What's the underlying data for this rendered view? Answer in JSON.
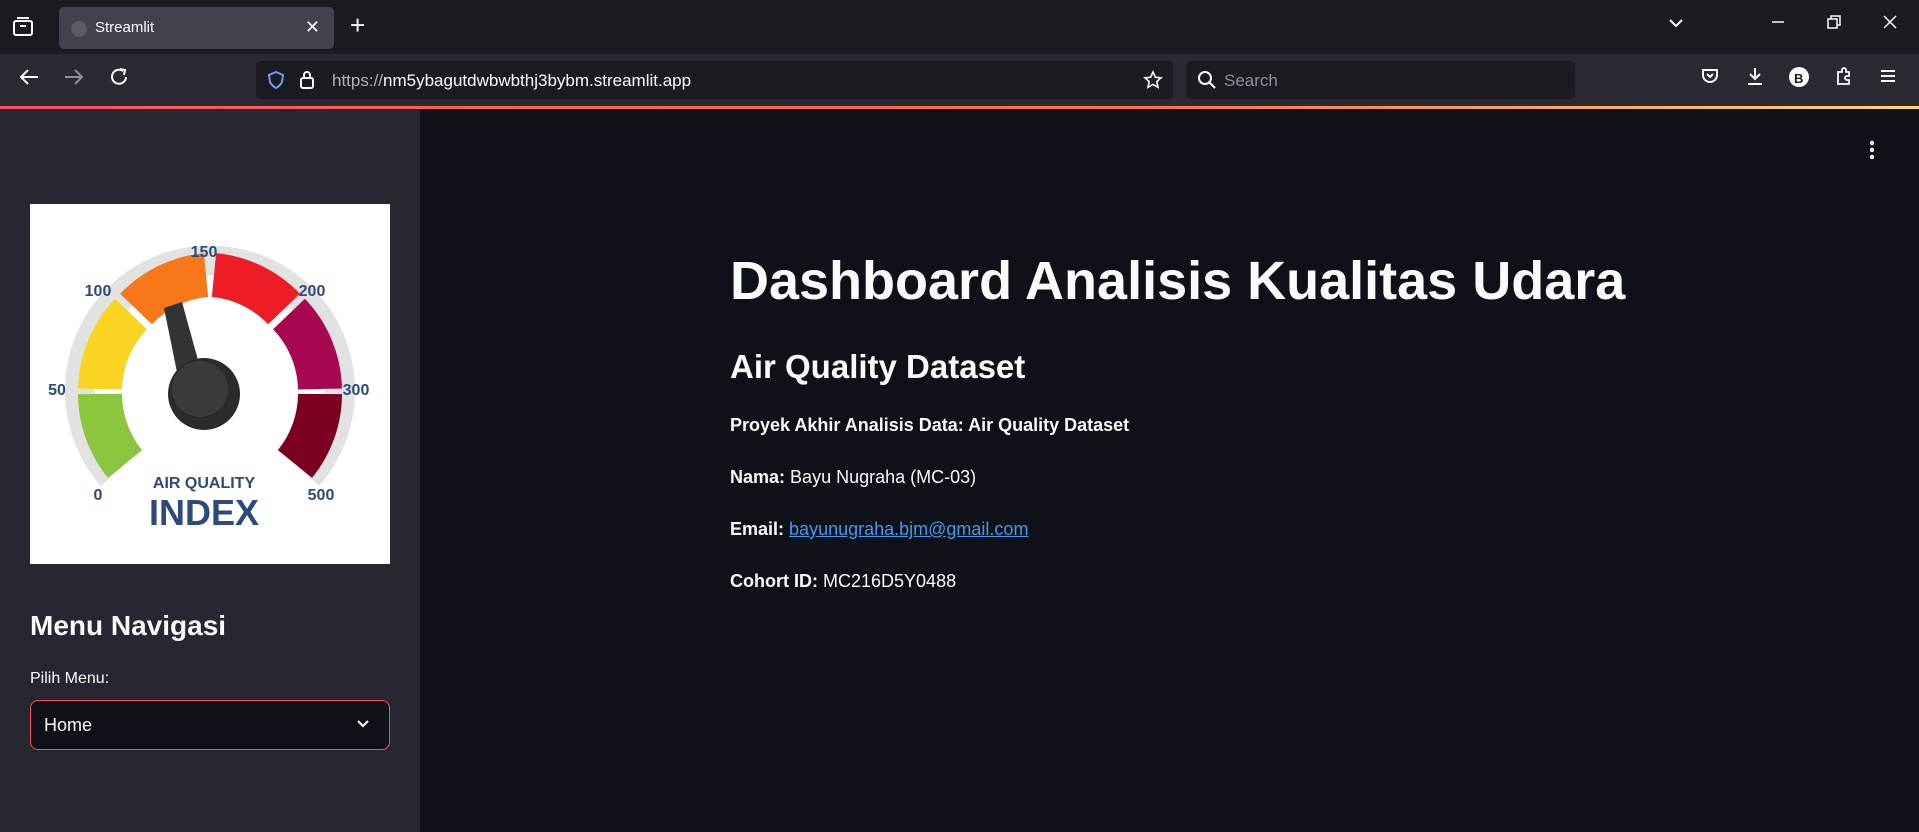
{
  "browser": {
    "tab_title": "Streamlit",
    "url_prefix": "https://",
    "url_host": "nm5ybagutdwbwbthj3bybm.streamlit.app",
    "search_placeholder": "Search",
    "profile_initial": "B"
  },
  "sidebar": {
    "gauge": {
      "labels": [
        "0",
        "50",
        "100",
        "150",
        "200",
        "300",
        "500"
      ],
      "caption_top": "AIR QUALITY",
      "caption_bottom": "INDEX"
    },
    "heading": "Menu Navigasi",
    "select_label": "Pilih Menu:",
    "select_value": "Home"
  },
  "main": {
    "title": "Dashboard Analisis Kualitas Udara",
    "subtitle": "Air Quality Dataset",
    "project": "Proyek Akhir Analisis Data: Air Quality Dataset",
    "name_label": "Nama:",
    "name_value": "Bayu Nugraha (MC-03)",
    "email_label": "Email:",
    "email_value": "bayunugraha.bjm@gmail.com",
    "cohort_label": "Cohort ID:",
    "cohort_value": "MC216D5Y0488"
  },
  "colors": {
    "accent": "#ff4b4b",
    "link": "#3d9df3",
    "app_bg": "#0e1117",
    "sidebar_bg": "#262730"
  }
}
